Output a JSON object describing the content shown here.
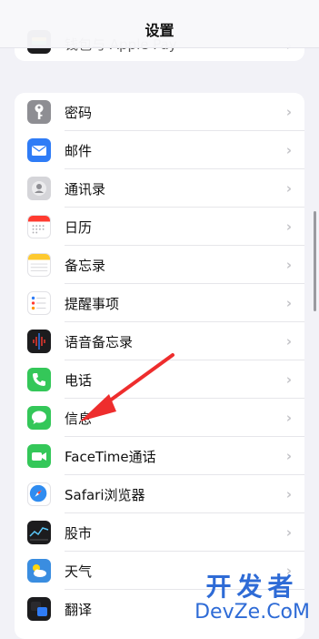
{
  "nav": {
    "title": "设置"
  },
  "top_group": {
    "label": "钱包与 Apple Pay"
  },
  "items": [
    {
      "label": "密码",
      "icon": "key-icon",
      "color": "#8e8e93"
    },
    {
      "label": "邮件",
      "icon": "mail-icon",
      "color": "#2f7cf6"
    },
    {
      "label": "通讯录",
      "icon": "contacts-icon",
      "color": "#d0d0d4"
    },
    {
      "label": "日历",
      "icon": "calendar-icon",
      "color": "#ffffff"
    },
    {
      "label": "备忘录",
      "icon": "notes-icon",
      "color": "#ffffff"
    },
    {
      "label": "提醒事项",
      "icon": "reminders-icon",
      "color": "#ffffff"
    },
    {
      "label": "语音备忘录",
      "icon": "voice-memos-icon",
      "color": "#1c1c1e"
    },
    {
      "label": "电话",
      "icon": "phone-icon",
      "color": "#34c759"
    },
    {
      "label": "信息",
      "icon": "messages-icon",
      "color": "#34c759"
    },
    {
      "label": "FaceTime通话",
      "icon": "facetime-icon",
      "color": "#34c759"
    },
    {
      "label": "Safari浏览器",
      "icon": "safari-icon",
      "color": "#ffffff"
    },
    {
      "label": "股市",
      "icon": "stocks-icon",
      "color": "#1c1c1e"
    },
    {
      "label": "天气",
      "icon": "weather-icon",
      "color": "#3a8de0"
    },
    {
      "label": "翻译",
      "icon": "translate-icon",
      "color": "#1c1c1e"
    }
  ],
  "watermark": {
    "top": "开发者",
    "bottom": "DevZe.CoM"
  }
}
